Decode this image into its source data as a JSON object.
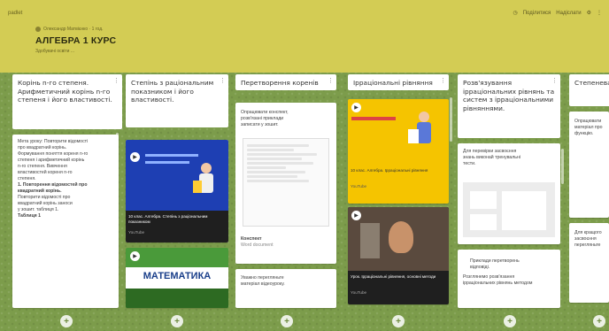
{
  "app": {
    "brand": "padlet"
  },
  "header": {
    "breadcrumb": "Олександр Матвієнко · 1 год.",
    "title": "АЛГЕБРА 1 КУРС",
    "subtitle": "Здобувачі освіти ...",
    "actions": [
      "Поділитися",
      "Надіслати"
    ]
  },
  "columns": [
    {
      "title": "Корінь n-го степеня. Арифметичний корінь n-го степеня і його властивості.",
      "cards": [
        {
          "lines": [
            "Мета уроку: Повторити відомості",
            "про квадратний корінь.",
            "Формування поняття кореня n-го",
            "степеня і арифметичний корінь",
            "n-го степеня. Вивчення",
            "властивостей кореня n-го",
            "степеня.",
            "1. Повторення відомостей про",
            "квадратний корінь.",
            "Повторити відомості про",
            "квадратний корінь заноси",
            "у зошит. таблиця 1.",
            "Таблиця 1"
          ]
        }
      ]
    },
    {
      "title": "Степінь з раціональним показником і його властивості.",
      "cards": [
        {
          "caption": "10 клас. Алгебра. Степінь з раціональним показником",
          "source": "YouTube"
        },
        {
          "book_title": "МАТЕМАТИКА"
        }
      ]
    },
    {
      "title": "Перетворення коренів",
      "cards": [
        {
          "lines": [
            "Опрацювати конспект,",
            "розв'язані приклади",
            "записати у зошит."
          ],
          "footer": [
            "Конспект",
            "Word document"
          ]
        },
        {
          "lines": [
            "Уважно перегляньте",
            "матеріал відеоуроку."
          ]
        }
      ]
    },
    {
      "title": "Ірраціональні рівняння",
      "cards": [
        {
          "caption": "10 клас. Алгебра. Ірраціональні рівняння",
          "source": "YouTube"
        },
        {
          "caption": "Урок. Ірраціональні рівняння, основні методи",
          "source": "YouTube"
        }
      ]
    },
    {
      "title": "Розв'язування ірраціональних рівнянь та систем з ірраціональними рівняннями.",
      "cards": [
        {
          "lines": [
            "Для перевірки засвоєння",
            "знань виконай тренувальні",
            "тести."
          ]
        },
        {
          "lines": [
            "Приклади перетворень",
            "відповіді."
          ],
          "extra": [
            "Розглянемо розв'язання",
            "ірраціональних рівнянь методом"
          ]
        }
      ]
    },
    {
      "title": "Степенева функція",
      "cards": [
        {
          "lines": [
            "Опрацювати",
            "матеріал про",
            "функцію."
          ]
        },
        {
          "lines": [
            "Для кращого",
            "засвоєння",
            "перегляньте"
          ]
        }
      ]
    }
  ],
  "colors": {
    "header": "#d3cc54",
    "board": "#7c9c4b",
    "video_bg": "#1e3fb3",
    "video_yellow": "#f5c400",
    "book_green": "#4a9a3a"
  }
}
